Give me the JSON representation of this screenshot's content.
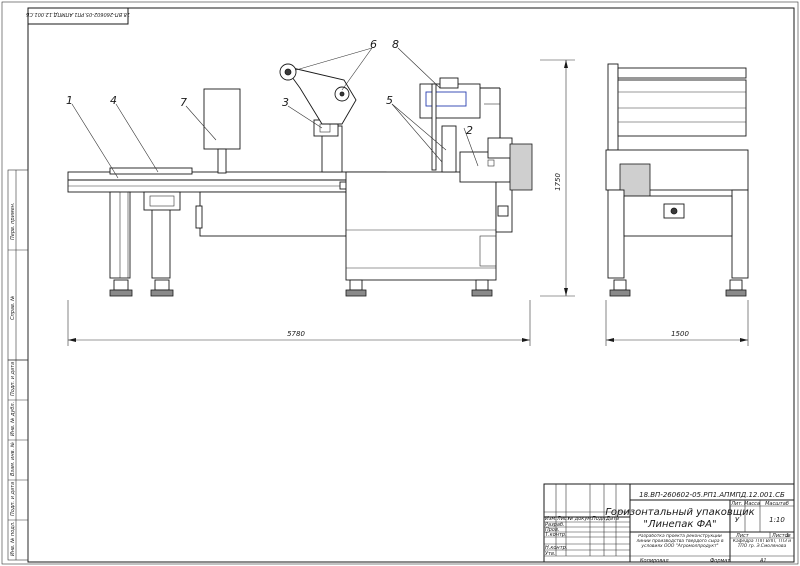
{
  "stamp_top": "18.ВП-260602-05.РП1.АПМПД.12.001.СБ",
  "callouts": [
    "1",
    "4",
    "7",
    "3",
    "6",
    "8",
    "5",
    "2"
  ],
  "dimensions": {
    "front_length": "5780",
    "side_width": "1500",
    "height": "1750"
  },
  "title_block": {
    "doc_code": "18.ВП-260602-05.РП1.АПМПД.12.001.СБ",
    "title_line1": "Горизонтальный упаковщик",
    "title_line2": "\"Линепак ФА\"",
    "col_lit": "Лит.",
    "col_mass": "Масса",
    "col_scale": "Масштаб",
    "scale_value": "1:10",
    "sheet_label": "Лист",
    "sheets_label": "Листов",
    "sheets_value": "1",
    "lit_value": "У",
    "header_cols": [
      "Изм.",
      "Лист",
      "№ докум.",
      "Подп.",
      "Дата"
    ],
    "rows": [
      "Разраб.",
      "Пров.",
      "Т.контр.",
      "",
      "Н.контр.",
      "Утв."
    ],
    "description": "Разработка проекта реконструкции линии производства твердого сыра в условиях ООО \"Агромолпродукт\"",
    "org": "Кафедра ТПП ВЛП, ТПЗ и ТПО гр. Э.Смолянова",
    "copied": "Копировал",
    "format_label": "Формат",
    "format_value": "А1"
  },
  "side_stamp": [
    "Перв. примен.",
    "Справ. №",
    "Подп. и дата",
    "Инв. № дубл.",
    "Взам. инв. №",
    "Подп. и дата",
    "Инв. № подл."
  ]
}
